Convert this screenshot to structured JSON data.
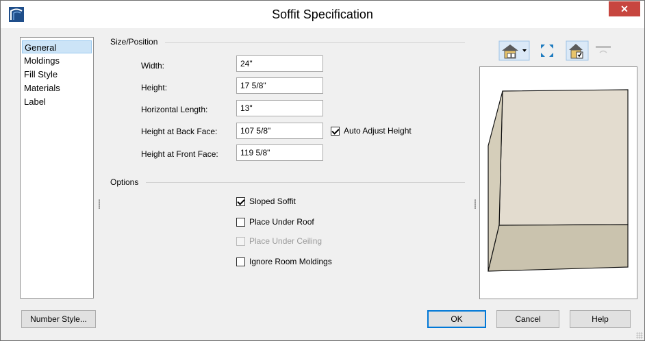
{
  "window": {
    "title": "Soffit Specification",
    "close_symbol": "✕"
  },
  "nav": {
    "items": [
      "General",
      "Moldings",
      "Fill Style",
      "Materials",
      "Label"
    ],
    "selected": "General"
  },
  "size_position": {
    "heading": "Size/Position",
    "fields": [
      {
        "label": "Width:",
        "value": "24\""
      },
      {
        "label": "Height:",
        "value": "17 5/8\""
      },
      {
        "label": "Horizontal Length:",
        "value": "13\""
      },
      {
        "label": "Height at Back Face:",
        "value": "107 5/8\""
      },
      {
        "label": "Height at Front Face:",
        "value": "119 5/8\""
      }
    ],
    "auto_adjust": {
      "label": "Auto Adjust Height",
      "checked": true
    }
  },
  "options": {
    "heading": "Options",
    "checkboxes": [
      {
        "label": "Sloped Soffit",
        "checked": true,
        "enabled": true
      },
      {
        "label": "Place Under Roof",
        "checked": false,
        "enabled": true
      },
      {
        "label": "Place Under Ceiling",
        "checked": false,
        "enabled": false
      },
      {
        "label": "Ignore Room Moldings",
        "checked": false,
        "enabled": true
      }
    ]
  },
  "toolbar": {
    "icons": [
      "view-type-dropdown-icon",
      "fill-window-icon",
      "toggle-preview-icon",
      "reset-view-icon"
    ]
  },
  "preview": {
    "face_color": "#e3dccf",
    "side_color": "#d5ceba",
    "bottom_color": "#cac3ae"
  },
  "buttons": {
    "number_style": "Number Style...",
    "ok": "OK",
    "cancel": "Cancel",
    "help": "Help"
  },
  "colors": {
    "close": "#c7463f",
    "selection": "#cce4f7",
    "default_border": "#0078d7"
  }
}
